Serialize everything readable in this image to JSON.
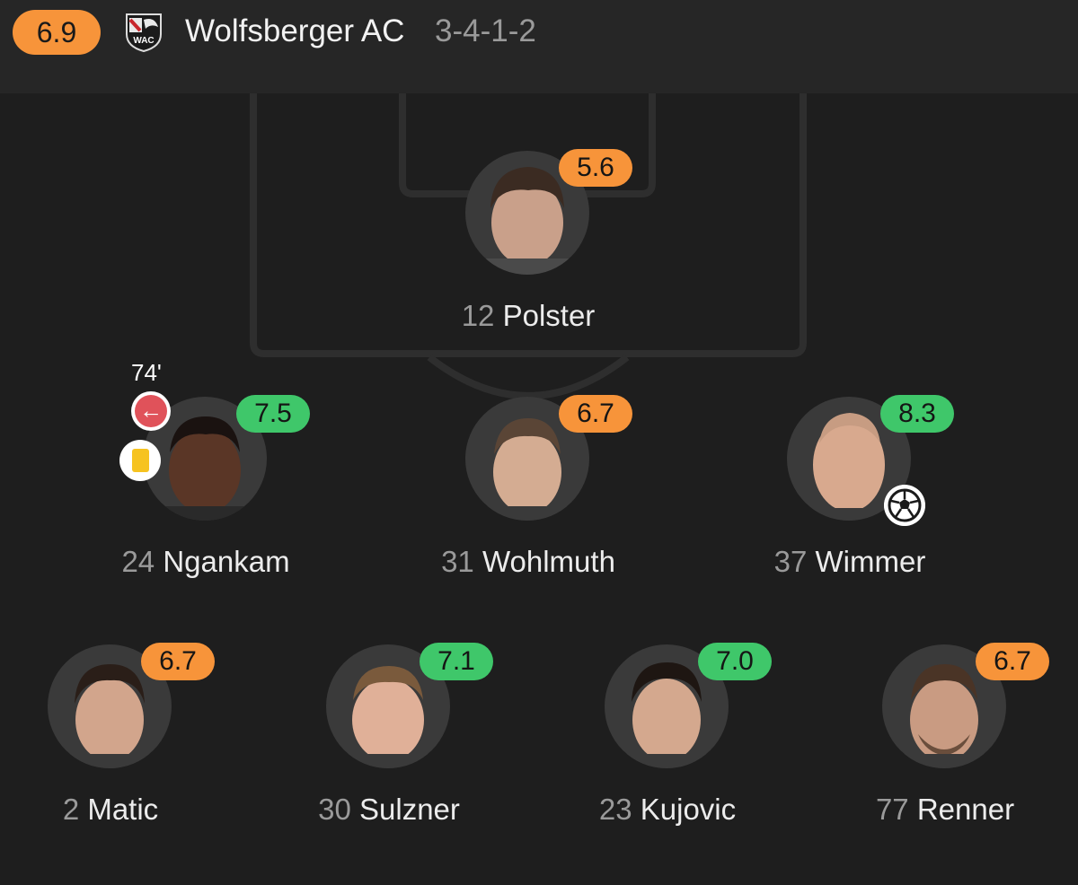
{
  "header": {
    "team_rating": "6.9",
    "team_name": "Wolfsberger AC",
    "formation": "3-4-1-2",
    "crest_icon": "wolfsberger-crest"
  },
  "colors": {
    "background": "#1e1e1e",
    "header": "#262626",
    "rating_orange": "#f7943a",
    "rating_green": "#3fc76a",
    "pitch_lines": "#2e2e2e"
  },
  "players": [
    {
      "number": "12",
      "name": "Polster",
      "rating": "5.6",
      "rating_color": "orange"
    },
    {
      "number": "24",
      "name": "Ngankam",
      "rating": "7.5",
      "rating_color": "green",
      "sub_minute": "74'",
      "events": [
        "substituted-out",
        "yellow-card"
      ]
    },
    {
      "number": "31",
      "name": "Wohlmuth",
      "rating": "6.7",
      "rating_color": "orange"
    },
    {
      "number": "37",
      "name": "Wimmer",
      "rating": "8.3",
      "rating_color": "green",
      "events": [
        "goal"
      ]
    },
    {
      "number": "2",
      "name": "Matic",
      "rating": "6.7",
      "rating_color": "orange"
    },
    {
      "number": "30",
      "name": "Sulzner",
      "rating": "7.1",
      "rating_color": "green"
    },
    {
      "number": "23",
      "name": "Kujovic",
      "rating": "7.0",
      "rating_color": "green"
    },
    {
      "number": "77",
      "name": "Renner",
      "rating": "6.7",
      "rating_color": "orange"
    }
  ]
}
